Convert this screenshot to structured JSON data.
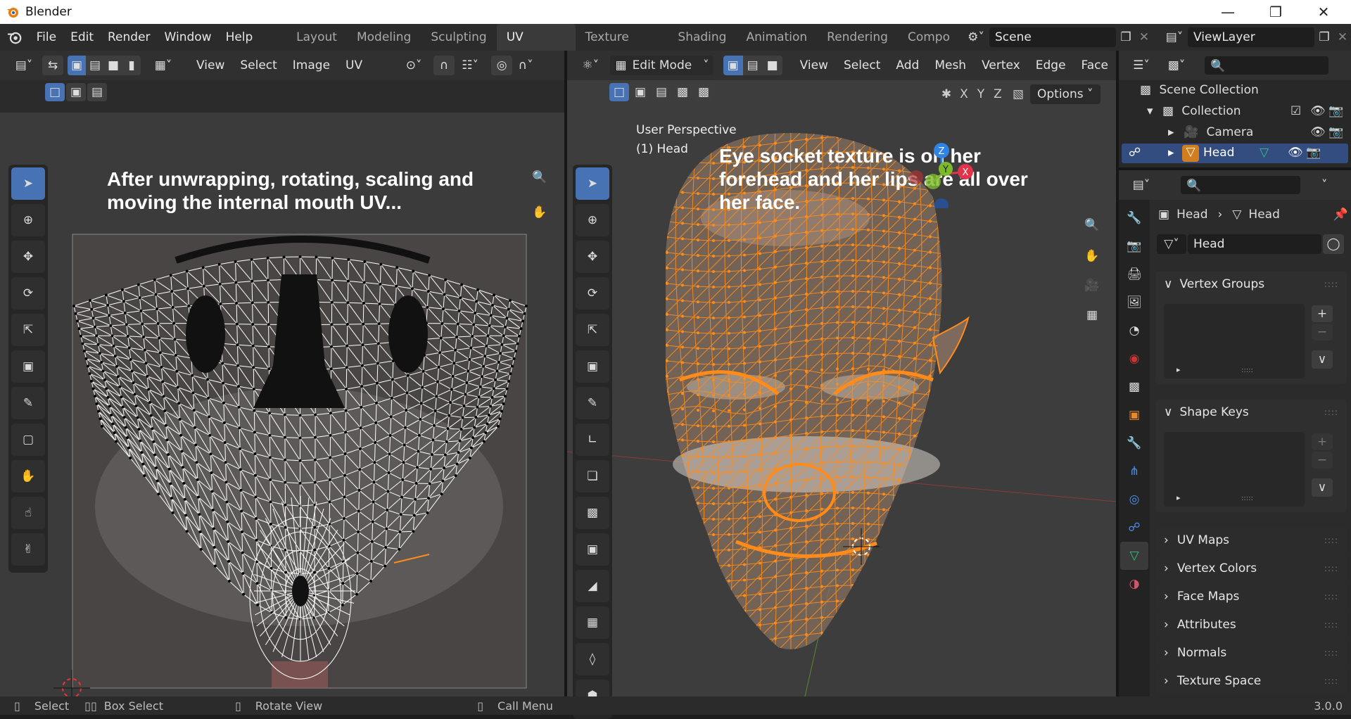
{
  "window": {
    "title": "Blender"
  },
  "menus": [
    "File",
    "Edit",
    "Render",
    "Window",
    "Help"
  ],
  "workspaces": [
    "Layout",
    "Modeling",
    "Sculpting",
    "UV Editing",
    "Texture Paint",
    "Shading",
    "Animation",
    "Rendering",
    "Compo"
  ],
  "active_workspace": "UV Editing",
  "scene": "Scene",
  "view_layer": "ViewLayer",
  "uv_editor": {
    "menus": [
      "View",
      "Select",
      "Image",
      "UV"
    ],
    "annotation_line1": "After unwrapping, rotating, scaling and",
    "annotation_line2": "moving the internal mouth UV..."
  },
  "viewport": {
    "mode": "Edit Mode",
    "menus": [
      "View",
      "Select",
      "Add",
      "Mesh",
      "Vertex",
      "Edge",
      "Face"
    ],
    "perspective": "User Perspective",
    "object_label": "(1) Head",
    "axis_x": "X",
    "axis_y": "Y",
    "axis_z": "Z",
    "options": "Options",
    "annotation_line1": "Eye socket texture is on her",
    "annotation_line2": "forehead and her lips are all over",
    "annotation_line3": "her face."
  },
  "outliner": {
    "scene_collection": "Scene Collection",
    "collection": "Collection",
    "items": [
      "Camera",
      "Head"
    ]
  },
  "properties": {
    "breadcrumb_object": "Head",
    "breadcrumb_data": "Head",
    "mesh_name": "Head",
    "panels": [
      "Vertex Groups",
      "Shape Keys",
      "UV Maps",
      "Vertex Colors",
      "Face Maps",
      "Attributes",
      "Normals",
      "Texture Space"
    ]
  },
  "statusbar": {
    "select": "Select",
    "box_select": "Box Select",
    "rotate": "Rotate View",
    "call_menu": "Call Menu",
    "version": "3.0.0"
  },
  "colors": {
    "accent": "#4772b3",
    "mesh_orange": "#ff8c1a",
    "uv_white": "#ffffff",
    "axis_x": "#e2334b",
    "axis_y": "#7dba2a",
    "axis_z": "#2f83e5"
  }
}
